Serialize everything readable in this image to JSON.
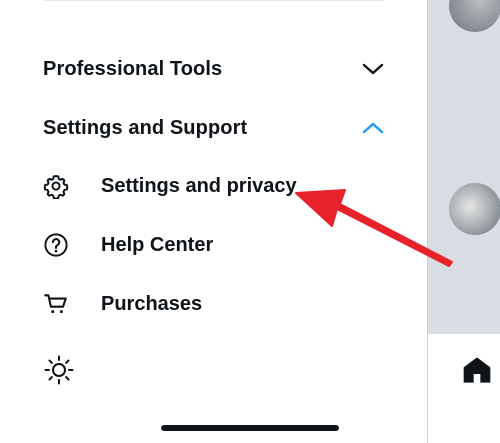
{
  "drawer": {
    "professional_tools": {
      "title": "Professional Tools",
      "state": "collapsed"
    },
    "settings_support": {
      "title": "Settings and Support",
      "state": "expanded"
    },
    "items": [
      {
        "label": "Settings and privacy",
        "icon": "gear-icon"
      },
      {
        "label": "Help Center",
        "icon": "help-circle-icon"
      },
      {
        "label": "Purchases",
        "icon": "cart-icon"
      }
    ],
    "theme_toggle_icon": "sun-icon"
  },
  "colors": {
    "accent": "#1d9bf0",
    "text": "#0f1419",
    "annotation_arrow": "#e8222a",
    "panel_bg": "#d7dde2"
  }
}
